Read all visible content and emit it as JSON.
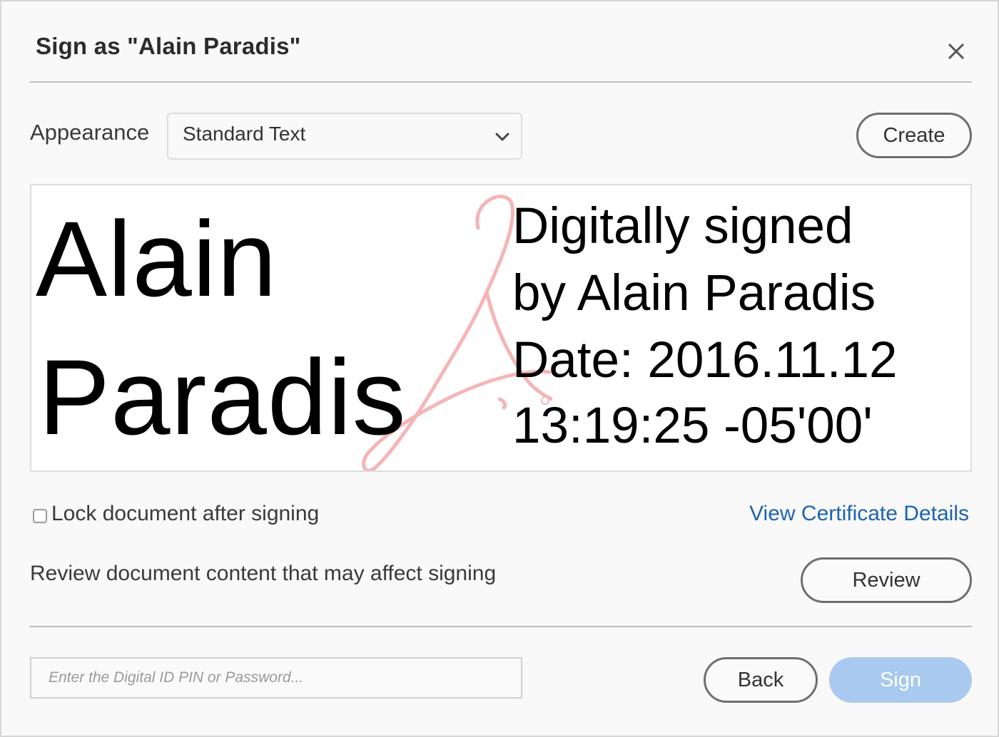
{
  "dialog": {
    "title": "Sign as \"Alain Paradis\"",
    "close_icon": "close-icon"
  },
  "appearance": {
    "label": "Appearance",
    "selected": "Standard Text",
    "chevron_icon": "chevron-down-icon",
    "create_label": "Create"
  },
  "preview": {
    "name_line1": "Alain",
    "name_line2": "Paradis",
    "info_line1": "Digitally signed",
    "info_line2": "by Alain Paradis",
    "info_line3": "Date: 2016.11.12",
    "info_line4": "13:19:25 -05'00'",
    "watermark_icon": "acrobat-logo-icon",
    "watermark_color": "#f5b5b5"
  },
  "options": {
    "lock_label": "Lock document after signing",
    "lock_checked": false,
    "cert_link": "View Certificate Details",
    "review_text": "Review document content that may affect signing",
    "review_label": "Review"
  },
  "footer": {
    "pin_placeholder": "Enter the Digital ID PIN or Password...",
    "pin_value": "",
    "back_label": "Back",
    "sign_label": "Sign"
  },
  "colors": {
    "link": "#1c64b0",
    "sign_button_disabled": "#a9c9ee",
    "button_border": "#6e6e6e"
  }
}
